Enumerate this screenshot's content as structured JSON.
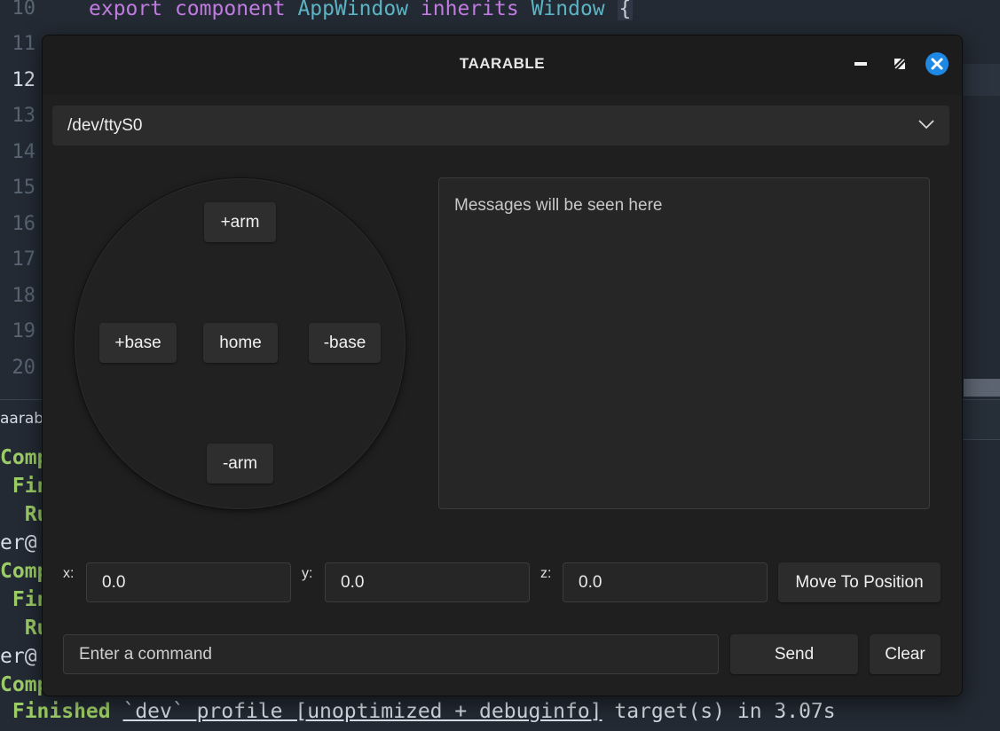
{
  "editor": {
    "line_numbers": [
      "10",
      "11",
      "12",
      "13",
      "14",
      "15",
      "16",
      "17",
      "18",
      "19",
      "20"
    ],
    "active_line": "12",
    "code": {
      "kw_export": "export",
      "kw_component": "component",
      "type_appwindow": "AppWindow",
      "kw_inherits": "inherits",
      "type_window": "Window",
      "brace": "{"
    }
  },
  "terminal": {
    "tab_label": "aarab",
    "lines": [
      {
        "green": "Comp",
        "rest": ""
      },
      {
        "green": " Fin",
        "rest": ""
      },
      {
        "green": "  Ru",
        "rest": ""
      },
      {
        "green": "",
        "rest": "er@"
      },
      {
        "green": "Comp",
        "rest": ""
      },
      {
        "green": " Fin",
        "rest": ""
      },
      {
        "green": "  Ru",
        "rest": ""
      },
      {
        "green": "",
        "rest": "er@"
      },
      {
        "green": "Comp",
        "rest": ""
      }
    ],
    "finished_green": " Finished",
    "finished_profile": "`dev` profile [unoptimized + debuginfo]",
    "finished_rest": " target(s) in 3.07s"
  },
  "window": {
    "title": "TAARABLE",
    "controls": {
      "minimize_icon": "minimize-icon",
      "maximize_icon": "maximize-icon",
      "close_icon": "close-icon",
      "close_color": "#1e88e5"
    },
    "port_select": {
      "value": "/dev/ttyS0",
      "icon": "chevron-down-icon"
    },
    "pad": {
      "plus_arm": "+arm",
      "plus_base": "+base",
      "home": "home",
      "minus_base": "-base",
      "minus_arm": "-arm"
    },
    "messages": {
      "placeholder": "Messages will be seen here"
    },
    "position": {
      "x_label": "x:",
      "x_value": "0.0",
      "y_label": "y:",
      "y_value": "0.0",
      "z_label": "z:",
      "z_value": "0.0",
      "move_button": "Move To Position"
    },
    "command": {
      "placeholder": "Enter a command",
      "send_button": "Send",
      "clear_button": "Clear"
    }
  }
}
